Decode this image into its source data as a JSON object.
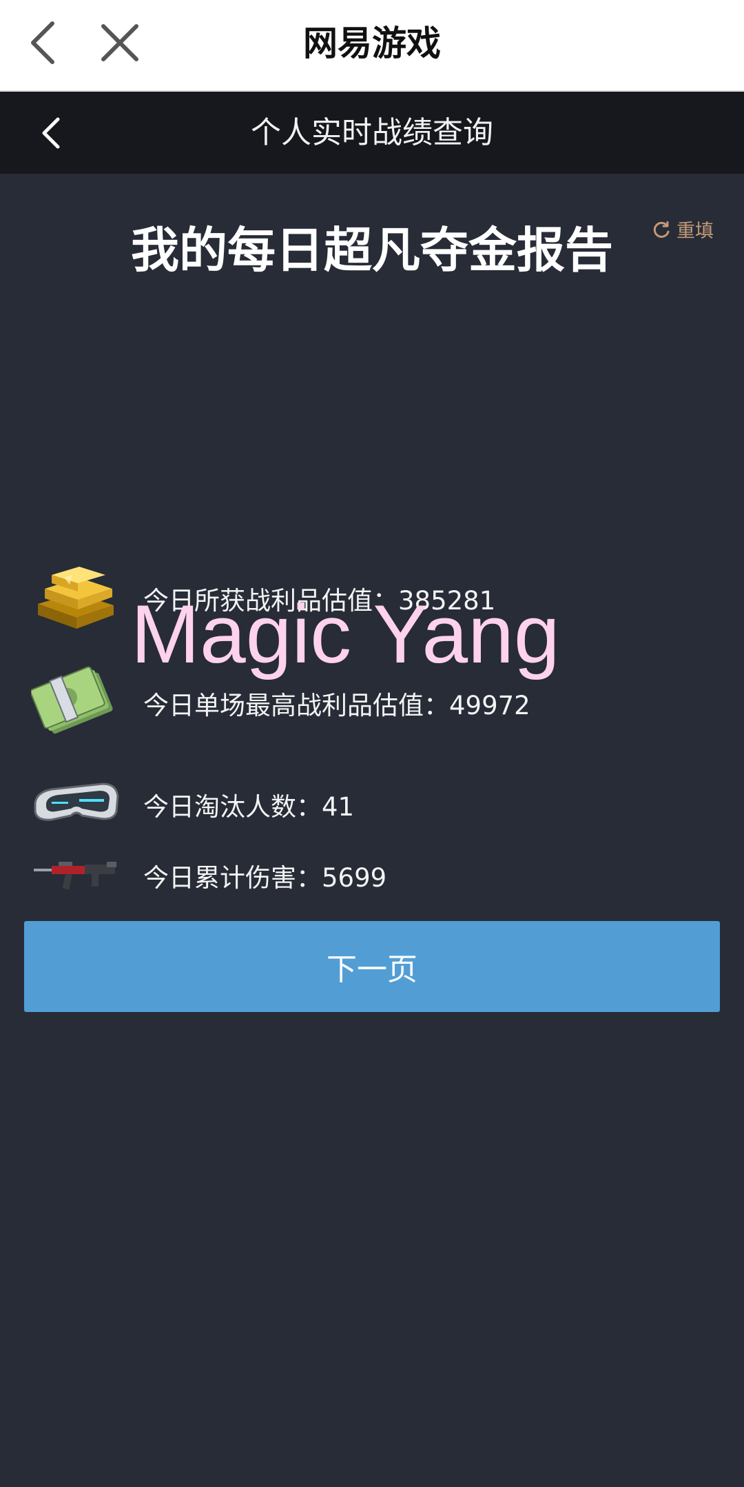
{
  "browser": {
    "title": "网易游戏",
    "back_icon": "chevron-left-icon",
    "close_icon": "close-icon"
  },
  "header": {
    "title": "个人实时战绩查询",
    "back_icon": "chevron-left-icon"
  },
  "report": {
    "title": "我的每日超凡夺金报告",
    "reset_label": "重填",
    "reset_icon": "refresh-icon"
  },
  "stats": [
    {
      "icon": "gold-bars-icon",
      "label": "今日所获战利品估值：385281"
    },
    {
      "icon": "cash-stack-icon",
      "label": "今日单场最高战利品估值：49972"
    },
    {
      "icon": "goggles-icon",
      "label": "今日淘汰人数：41"
    },
    {
      "icon": "rifle-icon",
      "label": "今日累计伤害：5699"
    }
  ],
  "watermark": "Magic Yang",
  "next_button": "下一页",
  "colors": {
    "background": "#272c37",
    "header_bg": "#16181d",
    "button": "#529ed4",
    "reset_accent": "#c49a76",
    "watermark": "#ffd2ec"
  }
}
